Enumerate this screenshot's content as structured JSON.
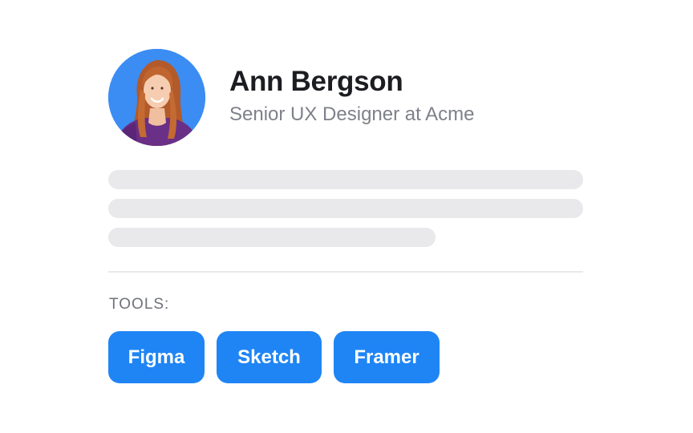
{
  "profile": {
    "name": "Ann Bergson",
    "title": "Senior UX Designer at Acme",
    "avatar_background": "#3b8df3"
  },
  "tools": {
    "label": "TOOLS:",
    "items": [
      {
        "label": "Figma"
      },
      {
        "label": "Sketch"
      },
      {
        "label": "Framer"
      }
    ],
    "chip_color": "#1f85f5"
  },
  "colors": {
    "placeholder": "#e9e9ec",
    "name_text": "#1c1d21",
    "subtitle_text": "#7e8189"
  }
}
